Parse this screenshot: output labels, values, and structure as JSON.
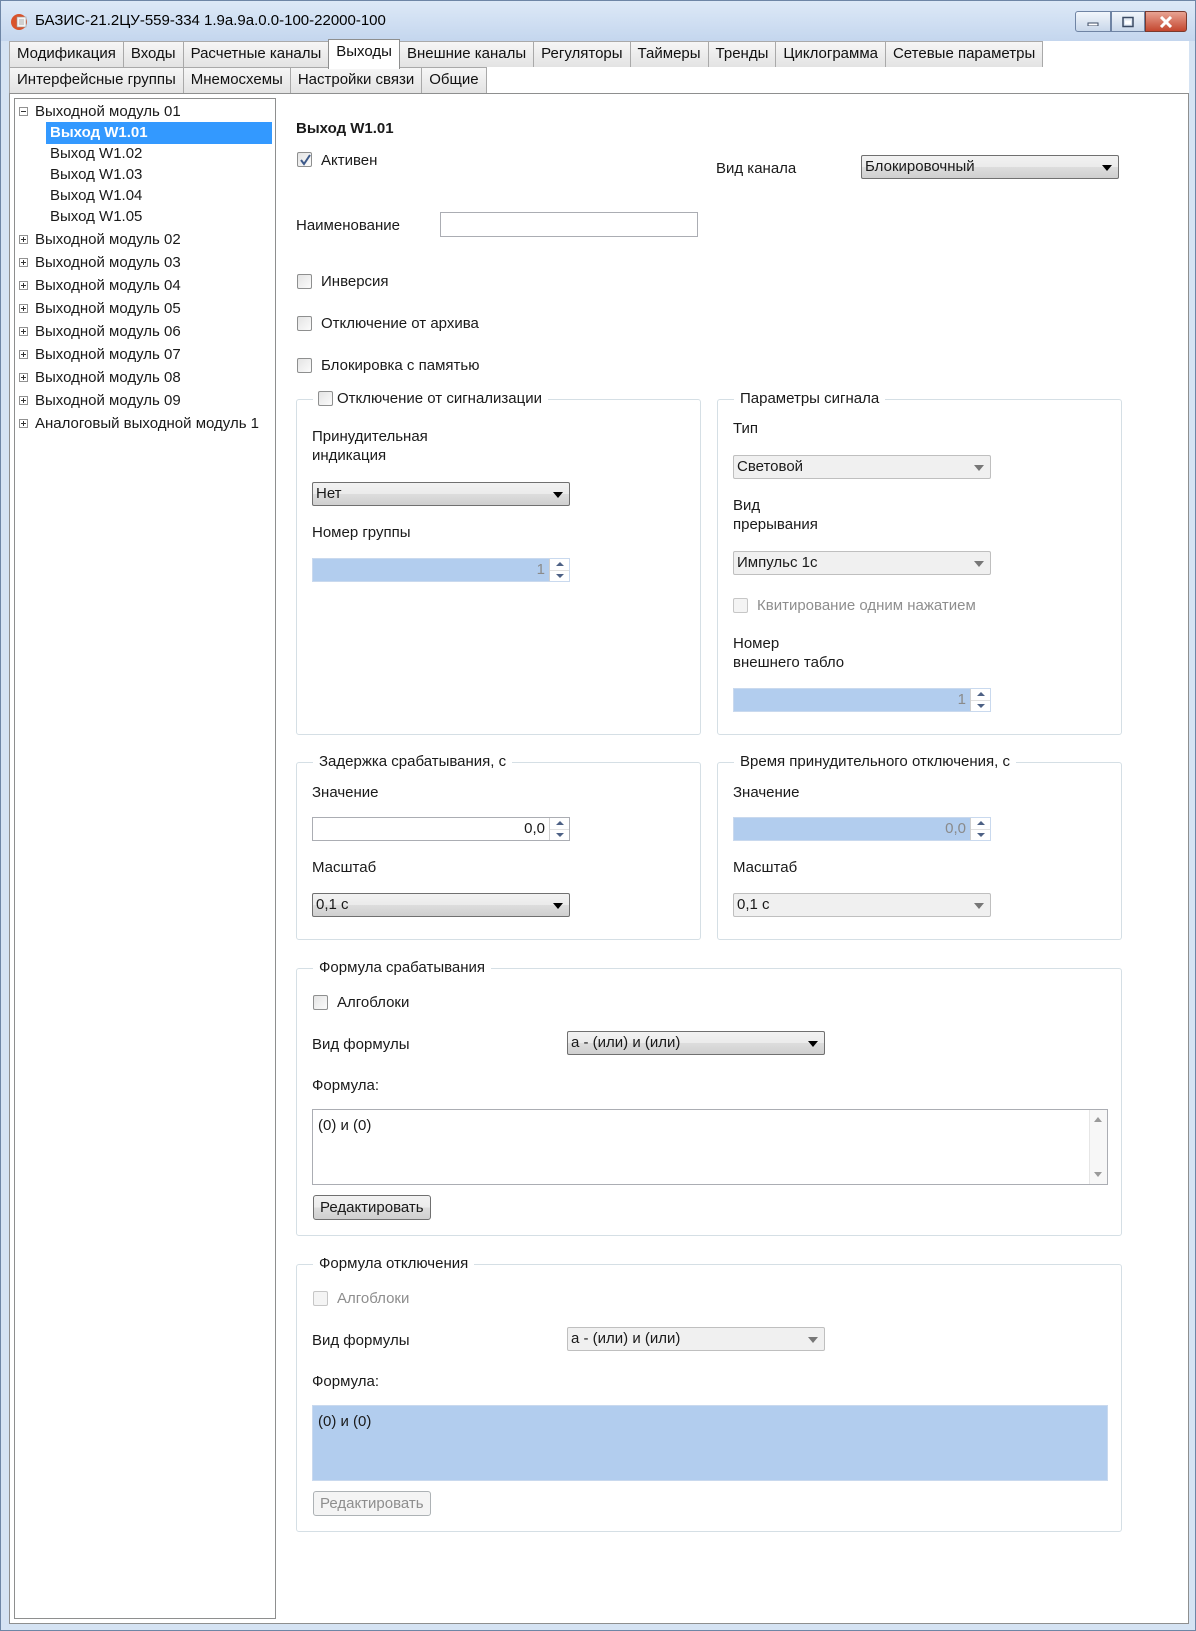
{
  "window": {
    "title": "БАЗИС-21.2ЦУ-559-334 1.9а.9а.0.0-100-22000-100"
  },
  "tabs": {
    "row1": [
      "Модификация",
      "Входы",
      "Расчетные каналы",
      "Выходы",
      "Внешние каналы",
      "Регуляторы",
      "Таймеры",
      "Тренды",
      "Циклограмма",
      "Сетевые параметры"
    ],
    "row2": [
      "Интерфейсные группы",
      "Мнемосхемы",
      "Настройки связи",
      "Общие"
    ],
    "active": "Выходы"
  },
  "tree": {
    "items": [
      {
        "label": "Выходной модуль 01",
        "expanded": true
      },
      {
        "label": "Выход W1.01",
        "selected": true
      },
      {
        "label": "Выход W1.02"
      },
      {
        "label": "Выход W1.03"
      },
      {
        "label": "Выход W1.04"
      },
      {
        "label": "Выход W1.05"
      },
      {
        "label": "Выходной модуль 02"
      },
      {
        "label": "Выходной модуль 03"
      },
      {
        "label": "Выходной модуль 04"
      },
      {
        "label": "Выходной модуль 05"
      },
      {
        "label": "Выходной модуль 06"
      },
      {
        "label": "Выходной модуль 07"
      },
      {
        "label": "Выходной модуль 08"
      },
      {
        "label": "Выходной модуль 09"
      },
      {
        "label": "Аналоговый выходной модуль 1"
      }
    ]
  },
  "form": {
    "heading": "Выход W1.01",
    "active_label": "Активен",
    "active_checked": true,
    "channel_type_label": "Вид канала",
    "channel_type_value": "Блокировочный",
    "name_label": "Наименование",
    "name_value": "",
    "inversion_label": "Инверсия",
    "archive_off_label": "Отключение от архива",
    "memory_lock_label": "Блокировка с памятью"
  },
  "alarm_group": {
    "title": "Отключение от сигнализации",
    "forced_label_1": "Принудительная",
    "forced_label_2": "индикация",
    "forced_value": "Нет",
    "group_number_label": "Номер группы",
    "group_number_value": "1"
  },
  "signal_group": {
    "title": "Параметры сигнала",
    "type_label": "Тип",
    "type_value": "Световой",
    "interrupt_label_1": "Вид",
    "interrupt_label_2": "прерывания",
    "interrupt_value": "Импульс 1с",
    "ack_label": "Квитирование одним нажатием",
    "display_label_1": "Номер",
    "display_label_2": "внешнего табло",
    "display_value": "1"
  },
  "delay_group": {
    "title": "Задержка срабатывания, с",
    "value_label": "Значение",
    "value": "0,0",
    "scale_label": "Масштаб",
    "scale_value": "0,1 с"
  },
  "forced_off_group": {
    "title": "Время принудительного отключения, с",
    "value_label": "Значение",
    "value": "0,0",
    "scale_label": "Масштаб",
    "scale_value": "0,1 с"
  },
  "trigger_formula": {
    "title": "Формула срабатывания",
    "algoblocks_label": "Алгоблоки",
    "formula_type_label": "Вид формулы",
    "formula_type_value": "а - (или) и (или)",
    "formula_label": "Формула:",
    "formula_text": "(0) и (0)",
    "edit_button": "Редактировать"
  },
  "off_formula": {
    "title": "Формула отключения",
    "algoblocks_label": "Алгоблоки",
    "formula_type_label": "Вид формулы",
    "formula_type_value": "а - (или) и (или)",
    "formula_label": "Формула:",
    "formula_text": "(0) и (0)",
    "edit_button": "Редактировать"
  },
  "colors": {
    "selection": "#3399ff",
    "disabled_field": "#b2cdee",
    "title_bar": "#c4d6ee",
    "close_button": "#c4472f"
  },
  "icons": [
    "app-icon",
    "minimize-icon",
    "maximize-icon",
    "close-icon",
    "checkmark-icon",
    "dropdown-arrow-icon",
    "spin-up-icon",
    "spin-down-icon",
    "tree-collapse-icon",
    "tree-expand-icon"
  ]
}
